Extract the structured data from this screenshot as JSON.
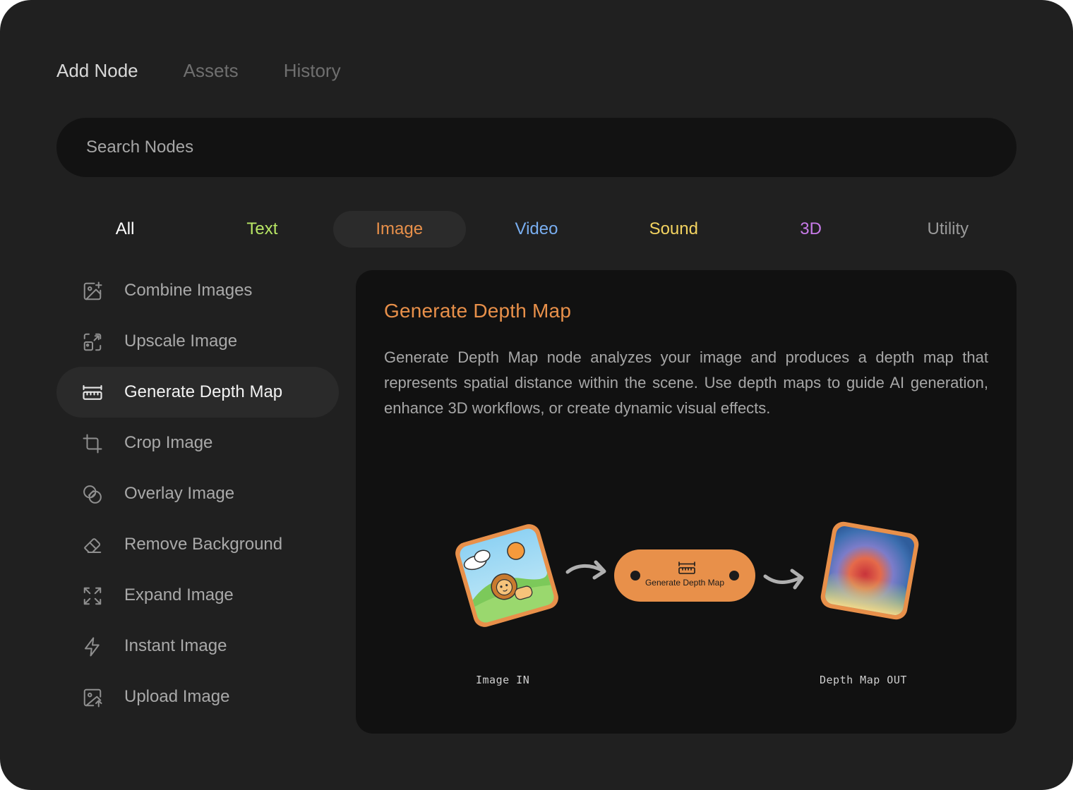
{
  "tabs": [
    "Add Node",
    "Assets",
    "History"
  ],
  "active_tab": "Add Node",
  "search": {
    "placeholder": "Search Nodes",
    "value": ""
  },
  "categories": [
    {
      "label": "All",
      "color": "#ffffff"
    },
    {
      "label": "Text",
      "color": "#b7e564"
    },
    {
      "label": "Image",
      "color": "#e8904a"
    },
    {
      "label": "Video",
      "color": "#79aef0"
    },
    {
      "label": "Sound",
      "color": "#f3d360"
    },
    {
      "label": "3D",
      "color": "#c77ae8"
    },
    {
      "label": "Utility",
      "color": "#9a9a9a"
    }
  ],
  "active_category": "Image",
  "nodes": [
    {
      "label": "Combine Images",
      "icon": "image-plus-icon"
    },
    {
      "label": "Upscale Image",
      "icon": "upscale-icon"
    },
    {
      "label": "Generate Depth Map",
      "icon": "ruler-icon"
    },
    {
      "label": "Crop Image",
      "icon": "crop-icon"
    },
    {
      "label": "Overlay Image",
      "icon": "overlay-icon"
    },
    {
      "label": "Remove Background",
      "icon": "eraser-icon"
    },
    {
      "label": "Expand Image",
      "icon": "expand-icon"
    },
    {
      "label": "Instant Image",
      "icon": "lightning-icon"
    },
    {
      "label": "Upload Image",
      "icon": "image-upload-icon"
    }
  ],
  "active_node": "Generate Depth Map",
  "detail": {
    "title": "Generate Depth Map",
    "description": "Generate Depth Map node analyzes your image and produces a depth map that represents spatial distance within the scene. Use depth maps to guide AI generation, enhance 3D workflows, or create dynamic visual effects.",
    "node_label": "Generate Depth Map",
    "input_caption": "Image IN",
    "output_caption": "Depth Map OUT"
  },
  "colors": {
    "accent": "#e8904a",
    "panel_bg": "#202020",
    "detail_bg": "#111111"
  }
}
